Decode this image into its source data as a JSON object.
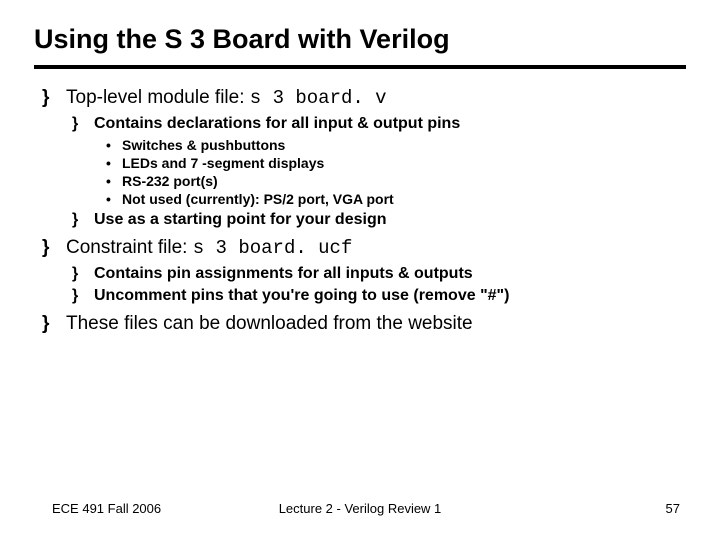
{
  "title": "Using the S 3 Board with Verilog",
  "bullets": {
    "b1_pre": "Top-level module file: ",
    "b1_code": "s 3 board. v",
    "b1_1": "Contains declarations for all input & output pins",
    "b1_1_1": "Switches & pushbuttons",
    "b1_1_2": "LEDs and 7 -segment displays",
    "b1_1_3": "RS-232 port(s)",
    "b1_1_4": "Not used (currently): PS/2 port, VGA port",
    "b1_2": "Use as a starting point for your design",
    "b2_pre": "Constraint file: ",
    "b2_code": "s 3 board. ucf",
    "b2_1": "Contains pin assignments for all inputs & outputs",
    "b2_2": "Uncomment pins that you're going to use (remove \"#\")",
    "b3": "These files can be downloaded from the website"
  },
  "footer": {
    "left": "ECE 491 Fall 2006",
    "center": "Lecture 2 - Verilog Review 1",
    "right": "57"
  }
}
